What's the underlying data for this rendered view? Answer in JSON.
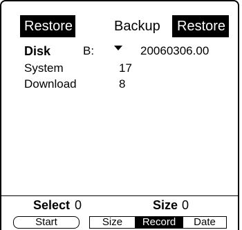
{
  "header": {
    "left_tab": "Restore",
    "center_title": "Backup",
    "right_tab": "Restore"
  },
  "disk_row": {
    "label": "Disk",
    "drive": "B:",
    "date": "20060306.00"
  },
  "items": [
    {
      "label": "System",
      "value": "17"
    },
    {
      "label": "Download",
      "value": "8"
    }
  ],
  "footer": {
    "select_label": "Select",
    "select_value": "0",
    "size_label": "Size",
    "size_value": "0"
  },
  "buttons": {
    "start": "Start",
    "size": "Size",
    "record": "Record",
    "date": "Date"
  }
}
